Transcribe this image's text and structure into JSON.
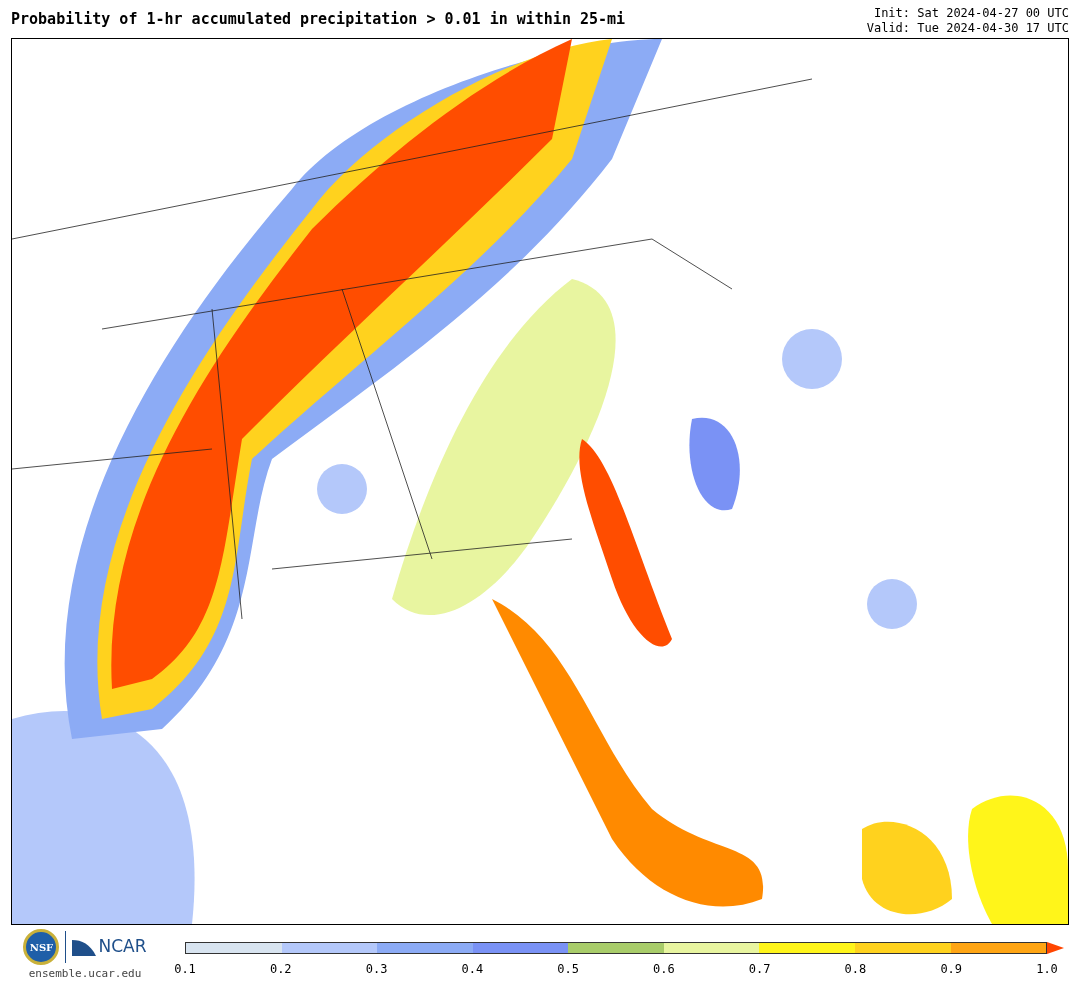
{
  "title": "Probability of 1-hr accumulated precipitation > 0.01 in within 25-mi",
  "init": "Init: Sat 2024-04-27 00 UTC",
  "valid": "Valid: Tue 2024-04-30 17 UTC",
  "logos": {
    "nsf": "NSF",
    "ncar": "NCAR",
    "url": "ensemble.ucar.edu"
  },
  "colorbar": {
    "segments": [
      {
        "kind": "box",
        "color": "#d8e4f0"
      },
      {
        "kind": "box",
        "color": "#b4c8fa"
      },
      {
        "kind": "box",
        "color": "#8cabf5"
      },
      {
        "kind": "box",
        "color": "#7a92f5"
      },
      {
        "kind": "box",
        "color": "#a8cc6a"
      },
      {
        "kind": "box",
        "color": "#e8f5a0"
      },
      {
        "kind": "box",
        "color": "#fff51a"
      },
      {
        "kind": "box",
        "color": "#ffd21e"
      },
      {
        "kind": "box",
        "color": "#ffa514"
      },
      {
        "kind": "arrow",
        "color": "#ff4500"
      }
    ],
    "ticks": [
      "0.1",
      "0.2",
      "0.3",
      "0.4",
      "0.5",
      "0.6",
      "0.7",
      "0.8",
      "0.9",
      "1.0"
    ]
  }
}
